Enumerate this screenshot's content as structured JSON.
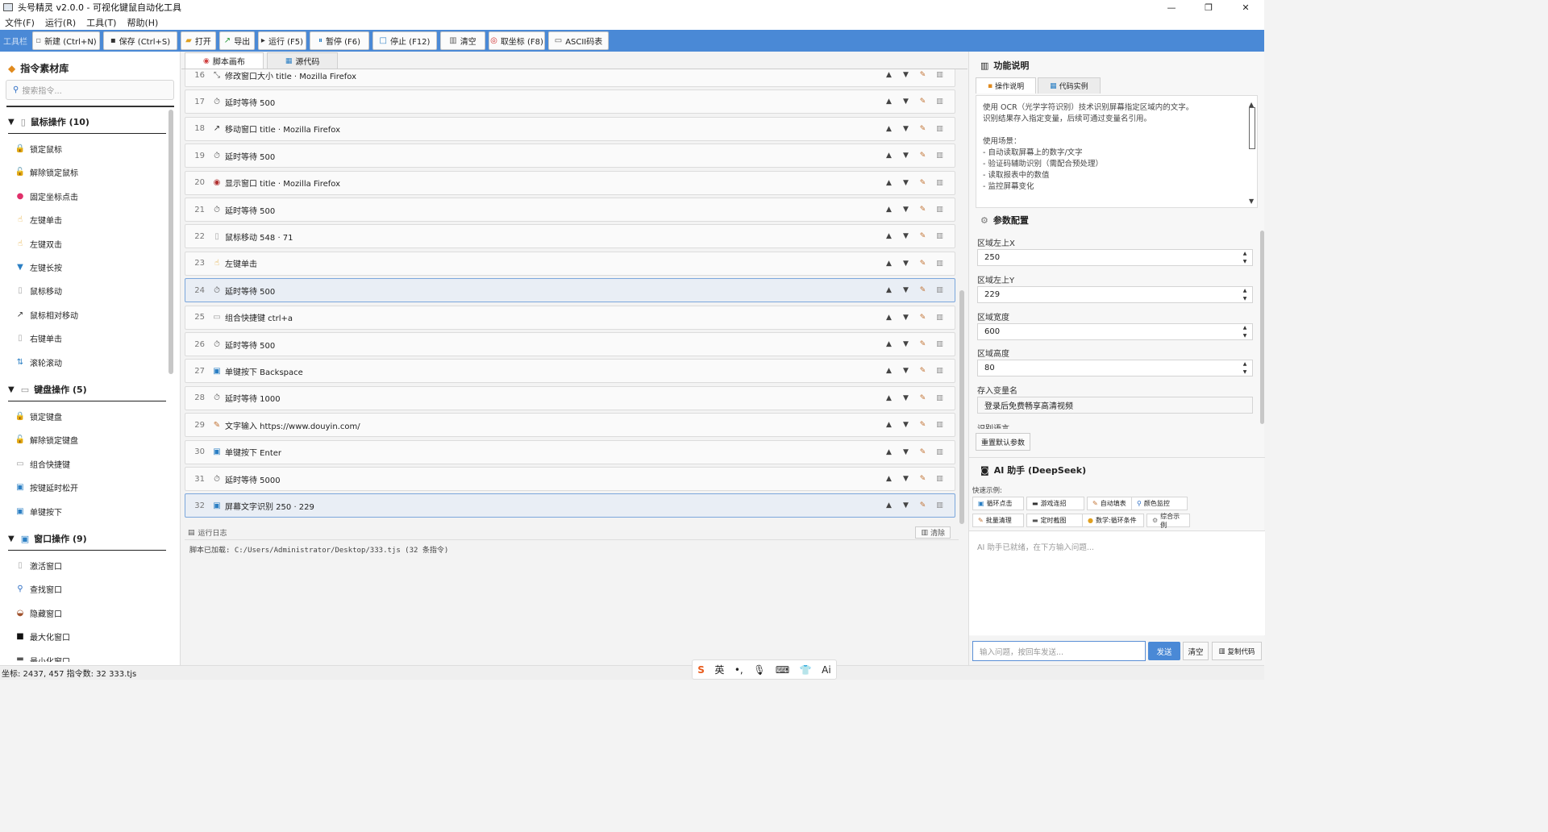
{
  "window": {
    "title": "头号精灵 v2.0.0 - 可视化键鼠自动化工具",
    "controls": {
      "minimize": "—",
      "maximize": "❐",
      "close": "✕"
    }
  },
  "menu": [
    "文件(F)",
    "运行(R)",
    "工具(T)",
    "帮助(H)"
  ],
  "toolbar": {
    "label": "工具栏",
    "buttons": [
      {
        "icon": "file-icon",
        "glyph": "▫",
        "label": "新建 (Ctrl+N)"
      },
      {
        "icon": "save-icon",
        "glyph": "▪",
        "label": "保存 (Ctrl+S)"
      },
      {
        "icon": "folder-icon",
        "glyph": "▰",
        "label": "打开"
      },
      {
        "icon": "export-icon",
        "glyph": "↗",
        "label": "导出"
      },
      {
        "icon": "play-icon",
        "glyph": "▸",
        "label": "运行 (F5)"
      },
      {
        "icon": "pause-icon",
        "glyph": "⏸",
        "label": "暂停 (F6)"
      },
      {
        "icon": "stop-icon",
        "glyph": "□",
        "label": "停止 (F12)"
      },
      {
        "icon": "trash-icon",
        "glyph": "▥",
        "label": "清空"
      },
      {
        "icon": "target-icon",
        "glyph": "◎",
        "label": "取坐标 (F8)"
      },
      {
        "icon": "keyboard-icon",
        "glyph": "▭",
        "label": "ASCII码表"
      }
    ]
  },
  "library": {
    "title": "指令素材库",
    "search_placeholder": "搜索指令...",
    "categories": [
      {
        "label": "鼠标操作 (10)",
        "items": [
          "锁定鼠标",
          "解除锁定鼠标",
          "固定坐标点击",
          "左键单击",
          "左键双击",
          "左键长按",
          "鼠标移动",
          "鼠标相对移动",
          "右键单击",
          "滚轮滚动"
        ]
      },
      {
        "label": "键盘操作 (5)",
        "items": [
          "锁定键盘",
          "解除锁定键盘",
          "组合快捷键",
          "按键延时松开",
          "单键按下"
        ]
      },
      {
        "label": "窗口操作 (9)",
        "items": [
          "激活窗口",
          "查找窗口",
          "隐藏窗口",
          "最大化窗口",
          "最小化窗口"
        ]
      }
    ]
  },
  "editor": {
    "tabs": [
      {
        "icon": "canvas-icon",
        "label": "脚本画布"
      },
      {
        "icon": "code-icon",
        "label": "源代码"
      }
    ],
    "rows": [
      {
        "num": "16",
        "icon": "resize-icon",
        "glyph": "⤡",
        "text": "修改窗口大小  title · Mozilla Firefox"
      },
      {
        "num": "17",
        "icon": "timer-icon",
        "glyph": "⏱",
        "text": "延时等待  500"
      },
      {
        "num": "18",
        "icon": "move-icon",
        "glyph": "↗",
        "text": "移动窗口  title · Mozilla Firefox"
      },
      {
        "num": "19",
        "icon": "timer-icon",
        "glyph": "⏱",
        "text": "延时等待  500"
      },
      {
        "num": "20",
        "icon": "show-window-icon",
        "glyph": "◉",
        "text": "显示窗口  title ·  Mozilla Firefox"
      },
      {
        "num": "21",
        "icon": "timer-icon",
        "glyph": "⏱",
        "text": "延时等待  500"
      },
      {
        "num": "22",
        "icon": "mouse-icon",
        "glyph": "▯",
        "text": "鼠标移动  548 · 71"
      },
      {
        "num": "23",
        "icon": "hand-icon",
        "glyph": "☝",
        "text": "左键单击"
      },
      {
        "num": "24",
        "icon": "timer-icon",
        "glyph": "⏱",
        "text": "延时等待  500"
      },
      {
        "num": "25",
        "icon": "keyboard-icon",
        "glyph": "▭",
        "text": "组合快捷键  ctrl+a"
      },
      {
        "num": "26",
        "icon": "timer-icon",
        "glyph": "⏱",
        "text": "延时等待  500"
      },
      {
        "num": "27",
        "icon": "key-icon",
        "glyph": "▣",
        "text": "单键按下  Backspace"
      },
      {
        "num": "28",
        "icon": "timer-icon",
        "glyph": "⏱",
        "text": "延时等待  1000"
      },
      {
        "num": "29",
        "icon": "text-input-icon",
        "glyph": "✎",
        "text": "文字输入  https://www.douyin.com/"
      },
      {
        "num": "30",
        "icon": "key-icon",
        "glyph": "▣",
        "text": "单键按下  Enter"
      },
      {
        "num": "31",
        "icon": "timer-icon",
        "glyph": "⏱",
        "text": "延时等待  5000"
      },
      {
        "num": "32",
        "icon": "ocr-icon",
        "glyph": "▣",
        "text": "屏幕文字识别  250 · 229"
      }
    ],
    "log_label": "运行日志",
    "log_clear": "清除",
    "log_text": "脚本已加载: C:/Users/Administrator/Desktop/333.tjs (32 条指令)"
  },
  "help": {
    "title": "功能说明",
    "tabs": [
      "操作说明",
      "代码实例"
    ],
    "lines": [
      "使用 OCR（光学字符识别）技术识别屏幕指定区域内的文字。",
      "识别结果存入指定变量，后续可通过变量名引用。",
      "",
      "使用场景：",
      "- 自动读取屏幕上的数字/文字",
      "- 验证码辅助识别（需配合预处理）",
      "- 读取报表中的数值",
      "- 监控屏幕变化"
    ]
  },
  "params": {
    "title": "参数配置",
    "fields": [
      {
        "label": "区域左上X",
        "value": "250"
      },
      {
        "label": "区域左上Y",
        "value": "229"
      },
      {
        "label": "区域宽度",
        "value": "600"
      },
      {
        "label": "区域高度",
        "value": "80"
      },
      {
        "label": "存入变量名",
        "value": "登录后免费畅享高清视频"
      }
    ],
    "next_label": "识别语言",
    "reset": "重置默认参数"
  },
  "ai": {
    "title": "AI 助手 (DeepSeek)",
    "quick_label": "快速示例:",
    "quick": [
      "循环点击",
      "游戏连招",
      "自动填表",
      "颜色监控",
      "批量清理",
      "定时截图",
      "数学:循环条件",
      "综合示例"
    ],
    "placeholder": "AI 助手已就绪，在下方输入问题...",
    "input_placeholder": "输入问题，按回车发送...",
    "send": "发送",
    "clear": "清空",
    "copy": "复制代码"
  },
  "status": "坐标: 2437, 457  指令数: 32  333.tjs",
  "ime": {
    "mode": "英",
    "s": "S"
  }
}
